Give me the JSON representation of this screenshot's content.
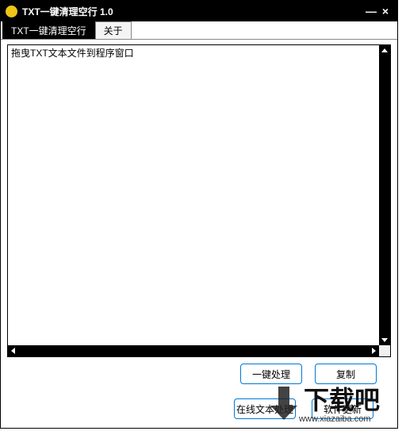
{
  "titlebar": {
    "icon": "app-icon",
    "title": "TXT一键清理空行 1.0"
  },
  "tabs": {
    "main": "TXT一键清理空行",
    "about": "关于"
  },
  "textarea": {
    "placeholder": "拖曳TXT文本文件到程序窗口",
    "value": ""
  },
  "buttons": {
    "process": "一键处理",
    "copy": "复制",
    "online": "在线文本处理",
    "update": "软件更新"
  },
  "watermark": {
    "brand": "下载吧",
    "url": "www.xiazaiba.com"
  }
}
